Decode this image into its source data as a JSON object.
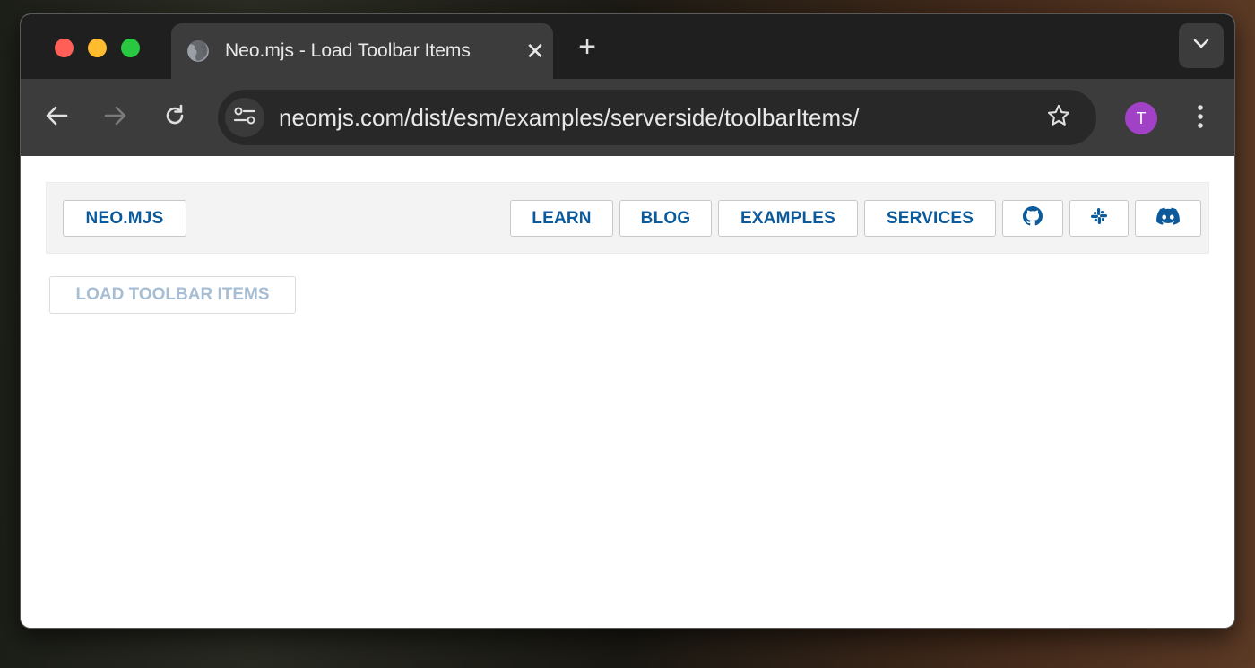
{
  "browser": {
    "tab": {
      "title": "Neo.mjs - Load Toolbar Items",
      "favicon": "globe-icon",
      "close_label": "✕"
    },
    "new_tab_label": "+",
    "url": "neomjs.com/dist/esm/examples/serverside/toolbarItems/",
    "profile_initial": "T",
    "colors": {
      "profile": "#a142c6",
      "close": "#ff5f57",
      "minimize": "#febc2e",
      "maximize": "#28c840"
    }
  },
  "header": {
    "brand_label": "NEO.MJS",
    "nav": [
      {
        "label": "LEARN"
      },
      {
        "label": "BLOG"
      },
      {
        "label": "EXAMPLES"
      },
      {
        "label": "SERVICES"
      }
    ],
    "icons": [
      "github-icon",
      "slack-icon",
      "discord-icon"
    ],
    "accent_color": "#0b5a9c"
  },
  "main": {
    "load_button_label": "LOAD TOOLBAR ITEMS",
    "load_button_state": "disabled"
  }
}
